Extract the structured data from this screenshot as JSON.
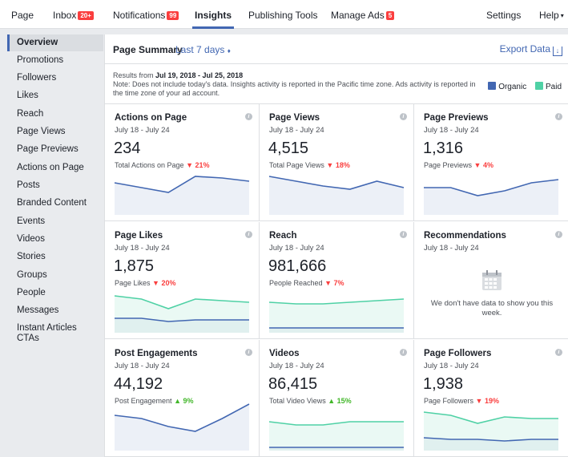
{
  "topnav": {
    "tabs": [
      {
        "label": "Page",
        "badge": ""
      },
      {
        "label": "Inbox",
        "badge": "20+"
      },
      {
        "label": "Notifications",
        "badge": "99"
      },
      {
        "label": "Insights",
        "badge": "",
        "active": true
      },
      {
        "label": "Publishing Tools",
        "badge": ""
      },
      {
        "label": "Manage Ads",
        "badge": "5"
      },
      {
        "label": "Settings",
        "badge": ""
      },
      {
        "label": "Help",
        "badge": ""
      }
    ],
    "help_caret": "▾"
  },
  "sidebar": {
    "items": [
      {
        "label": "Overview",
        "active": true
      },
      {
        "label": "Promotions"
      },
      {
        "label": "Followers"
      },
      {
        "label": "Likes"
      },
      {
        "label": "Reach"
      },
      {
        "label": "Page Views"
      },
      {
        "label": "Page Previews"
      },
      {
        "label": "Actions on Page"
      },
      {
        "label": "Posts"
      },
      {
        "label": "Branded Content"
      },
      {
        "label": "Events"
      },
      {
        "label": "Videos"
      },
      {
        "label": "Stories"
      },
      {
        "label": "Groups"
      },
      {
        "label": "People"
      },
      {
        "label": "Messages"
      },
      {
        "label": "Instant Articles CTAs"
      }
    ]
  },
  "summary": {
    "title": "Page Summary",
    "range": "Last 7 days",
    "range_caret": "♦",
    "export_label": "Export Data",
    "results_prefix": "Results from ",
    "results_range": "Jul 19, 2018 - Jul 25, 2018",
    "note": "Note: Does not include today's data. Insights activity is reported in the Pacific time zone. Ads activity is reported in the time zone of your ad account."
  },
  "legend": {
    "organic_label": "Organic",
    "paid_label": "Paid",
    "organic_color": "#4267b2",
    "paid_color": "#4fd1a5"
  },
  "cards": [
    {
      "title": "Actions on Page",
      "sub": "July 18 - July 24",
      "value": "234",
      "caption": "Total Actions on Page",
      "change": "21%",
      "dir": "down",
      "organic": [
        40,
        34,
        28,
        48,
        46,
        42
      ],
      "paid": null
    },
    {
      "title": "Page Views",
      "sub": "July 18 - July 24",
      "value": "4,515",
      "caption": "Total Page Views",
      "change": "18%",
      "dir": "down",
      "organic": [
        48,
        42,
        36,
        32,
        42,
        34
      ],
      "paid": null
    },
    {
      "title": "Page Previews",
      "sub": "July 18 - July 24",
      "value": "1,316",
      "caption": "Page Previews",
      "change": "4%",
      "dir": "down",
      "organic": [
        34,
        34,
        24,
        30,
        40,
        44
      ],
      "paid": null
    },
    {
      "title": "Page Likes",
      "sub": "July 18 - July 24",
      "value": "1,875",
      "caption": "Page Likes",
      "change": "20%",
      "dir": "down",
      "organic": [
        18,
        18,
        14,
        16,
        16,
        16
      ],
      "paid": [
        46,
        42,
        30,
        42,
        40,
        38
      ]
    },
    {
      "title": "Reach",
      "sub": "July 18 - July 24",
      "value": "981,666",
      "caption": "People Reached",
      "change": "7%",
      "dir": "down",
      "organic": [
        6,
        6,
        6,
        6,
        6,
        6
      ],
      "paid": [
        38,
        36,
        36,
        38,
        40,
        42
      ]
    },
    {
      "title": "Recommendations",
      "sub": "July 18 - July 24",
      "value": "",
      "caption": "",
      "change": "",
      "dir": "",
      "empty_text": "We don't have data to show you this week.",
      "organic": null,
      "paid": null
    },
    {
      "title": "Post Engagements",
      "sub": "July 18 - July 24",
      "value": "44,192",
      "caption": "Post Engagement",
      "change": "9%",
      "dir": "up",
      "organic": [
        44,
        40,
        30,
        24,
        40,
        58
      ],
      "paid": null
    },
    {
      "title": "Videos",
      "sub": "July 18 - July 24",
      "value": "86,415",
      "caption": "Total Video Views",
      "change": "15%",
      "dir": "up",
      "organic": [
        4,
        4,
        4,
        4,
        4,
        4
      ],
      "paid": [
        36,
        32,
        32,
        36,
        36,
        36
      ]
    },
    {
      "title": "Page Followers",
      "sub": "July 18 - July 24",
      "value": "1,938",
      "caption": "Page Followers",
      "change": "19%",
      "dir": "down",
      "organic": [
        16,
        14,
        14,
        12,
        14,
        14
      ],
      "paid": [
        48,
        44,
        34,
        42,
        40,
        40
      ]
    }
  ]
}
